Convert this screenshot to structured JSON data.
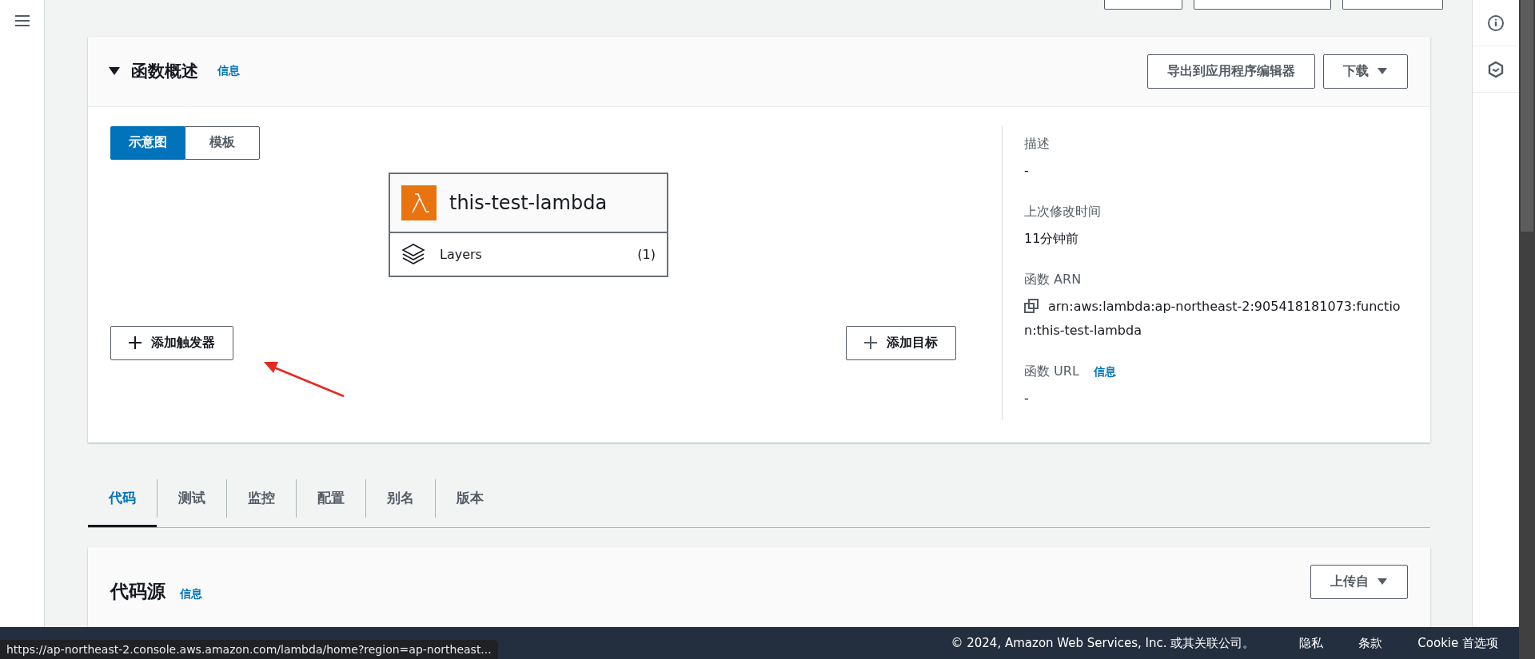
{
  "overview": {
    "title": "函数概述",
    "info_link": "信息",
    "actions": [
      {
        "label": "导出到应用程序编辑器",
        "kind": "plain"
      },
      {
        "label": "下载",
        "kind": "dropdown"
      }
    ],
    "view_toggle": [
      {
        "label": "示意图",
        "selected": true
      },
      {
        "label": "模板",
        "selected": false
      }
    ],
    "function_node": {
      "name": "this-test-lambda",
      "layers_label": "Layers",
      "layers_count": "(1)"
    },
    "add_trigger": "添加触发器",
    "add_target": "添加目标",
    "details": [
      {
        "label": "描述",
        "value": "-"
      },
      {
        "label": "上次修改时间",
        "value": "11分钟前"
      },
      {
        "label": "函数 ARN",
        "value": "arn:aws:lambda:ap-northeast-2:905418181073:function:this-test-lambda",
        "kind": "copy"
      },
      {
        "label": "函数 URL",
        "info_link": "信息",
        "value": "-"
      }
    ]
  },
  "tabs": [
    {
      "label": "代码",
      "selected": true
    },
    {
      "label": "测试",
      "selected": false
    },
    {
      "label": "监控",
      "selected": false
    },
    {
      "label": "配置",
      "selected": false
    },
    {
      "label": "别名",
      "selected": false
    },
    {
      "label": "版本",
      "selected": false
    }
  ],
  "code_source": {
    "title": "代码源",
    "info_link": "信息",
    "upload_button": "上传自"
  },
  "footer": {
    "copyright": "© 2024, Amazon Web Services, Inc. 或其关联公司。",
    "links": [
      "隐私",
      "条款",
      "Cookie 首选项"
    ]
  },
  "status_url": "https://ap-northeast-2.console.aws.amazon.com/lambda/home?region=ap-northeast..."
}
